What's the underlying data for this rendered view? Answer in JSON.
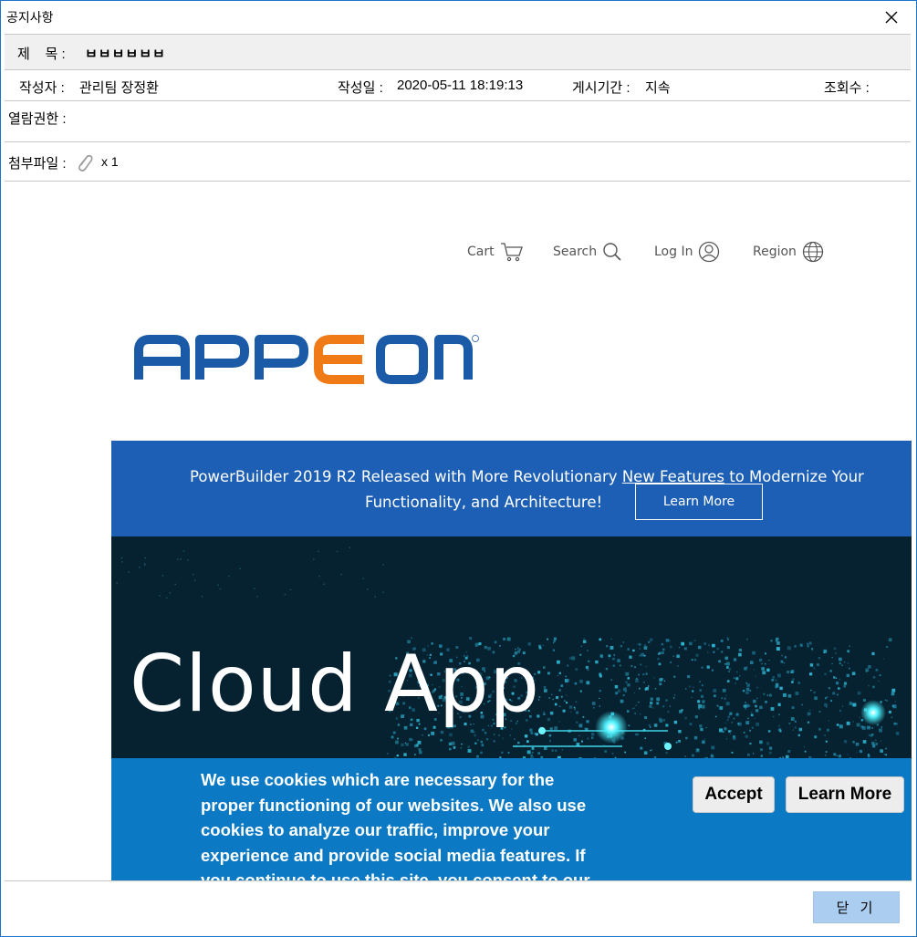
{
  "window": {
    "title": "공지사항"
  },
  "notice": {
    "subject_label": "제    목 :",
    "subject_value": "ㅂㅂㅂㅂㅂㅂ",
    "author_label": "작성자 :",
    "author_value": "관리팀 장정환",
    "date_label": "작성일 :",
    "date_value": "2020-05-11 18:19:13",
    "period_label": "게시기간 :",
    "period_value": "지속",
    "views_label": "조회수 :",
    "permission_label": "열람권한 :",
    "attachment_label": "첨부파일 :",
    "attachment_count": "x 1"
  },
  "site": {
    "nav": [
      {
        "label": "Cart",
        "icon": "cart-icon"
      },
      {
        "label": "Search",
        "icon": "search-icon"
      },
      {
        "label": "Log In",
        "icon": "user-icon"
      },
      {
        "label": "Region",
        "icon": "globe-icon"
      }
    ],
    "logo_text": "APPEON",
    "logo_colors": {
      "blue": "#1a5aa6",
      "orange": "#f07a16"
    },
    "banner": {
      "line1_pre": "PowerBuilder 2019 R2 Released with More Revolutionary ",
      "line1_link": "New Features",
      "line1_post": " to Modernize Your",
      "line2": "Functionality, and Architecture!",
      "button": "Learn More"
    },
    "hero_text": "Cloud App",
    "cookie": {
      "lines": [
        "We use cookies which are necessary for the",
        "proper functioning of our websites. We also use",
        "cookies to analyze our traffic, improve your",
        "experience and provide social media features. If",
        "you continue to use this site, you consent to our"
      ],
      "accept_button": "Accept",
      "learn_more_button": "Learn More"
    }
  },
  "footer": {
    "close_button": "닫 기"
  },
  "colors": {
    "banner_blue": "#1d5fb5",
    "hero_dark": "#062130",
    "cookie_blue": "#0b79c4",
    "footer_button": "#aacdf0"
  }
}
